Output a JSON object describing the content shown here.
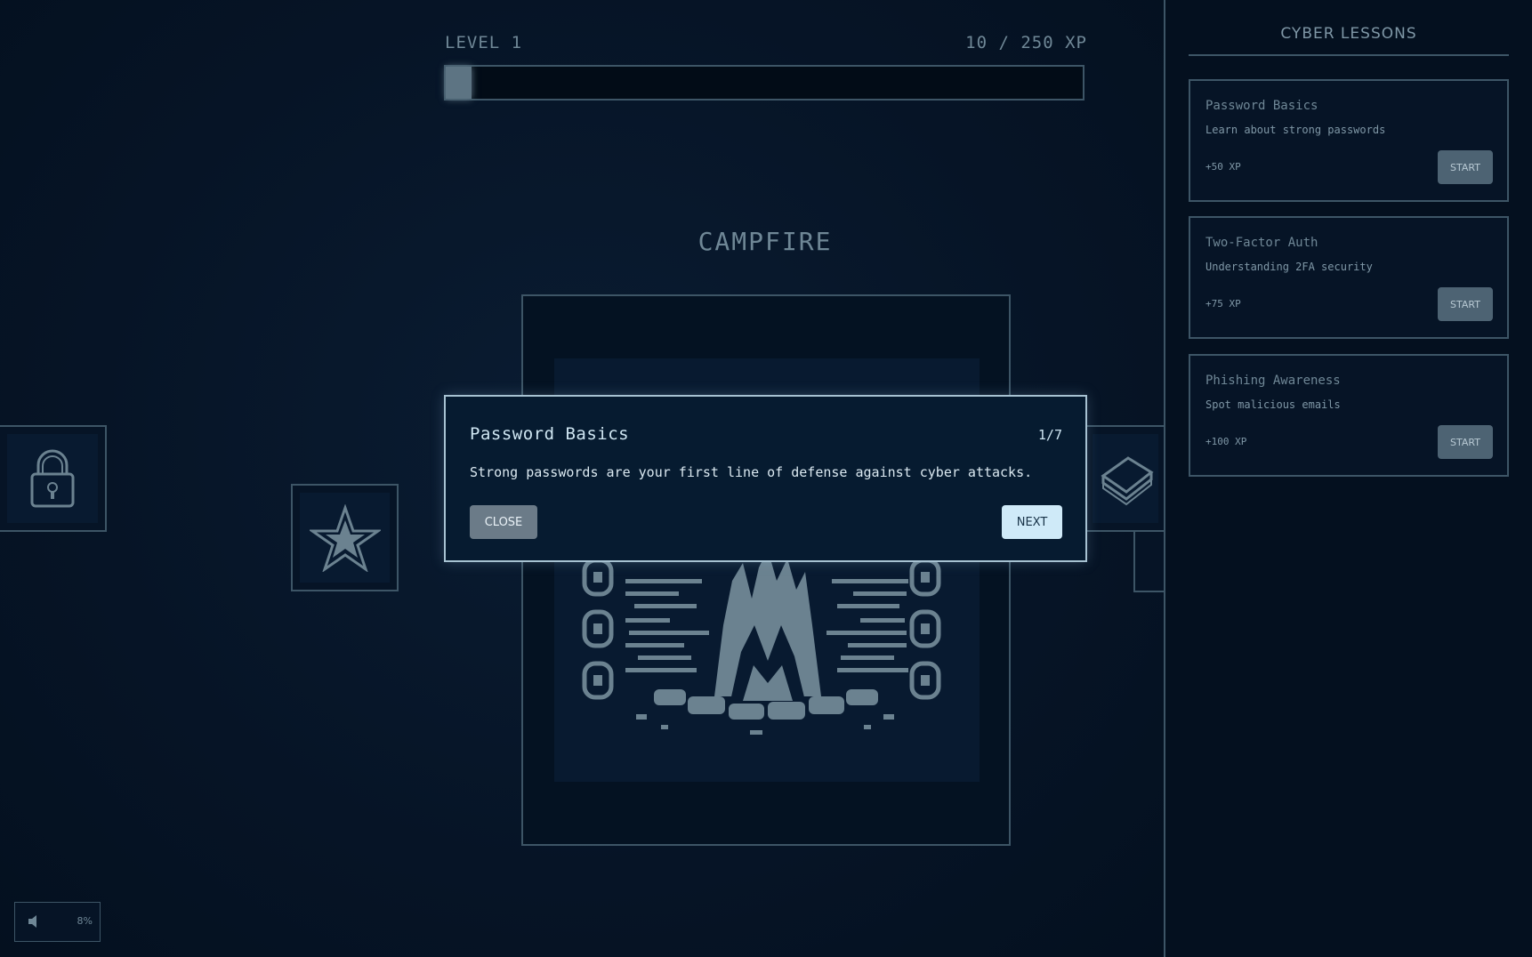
{
  "hud": {
    "level_label": "LEVEL 1",
    "xp_label": "10 / 250 XP",
    "xp_progress": 0.04
  },
  "scene": {
    "title": "CAMPFIRE"
  },
  "tiles": {
    "left_icon": "lock-icon",
    "star_icon": "star-icon",
    "right_icon": "book-icon"
  },
  "dialog": {
    "title": "Password Basics",
    "step": "1/7",
    "text": "Strong passwords are your first line of defense against cyber attacks.",
    "close_label": "CLOSE",
    "next_label": "NEXT"
  },
  "sidebar": {
    "title": "CYBER LESSONS",
    "lessons": [
      {
        "name": "Password Basics",
        "desc": "Learn about strong passwords",
        "xp": "+50 XP",
        "start_label": "START"
      },
      {
        "name": "Two-Factor Auth",
        "desc": "Understanding 2FA security",
        "xp": "+75 XP",
        "start_label": "START"
      },
      {
        "name": "Phishing Awareness",
        "desc": "Spot malicious emails",
        "xp": "+100 XP",
        "start_label": "START"
      }
    ]
  },
  "volume": {
    "icon": "speaker-icon",
    "percent": "8%"
  },
  "colors": {
    "background": "#061426",
    "border": "#3d5566",
    "text": "#6f8796",
    "dialog_border": "#a7c2d2",
    "next_button": "#cfeaf8",
    "close_button": "#6b7b88"
  }
}
